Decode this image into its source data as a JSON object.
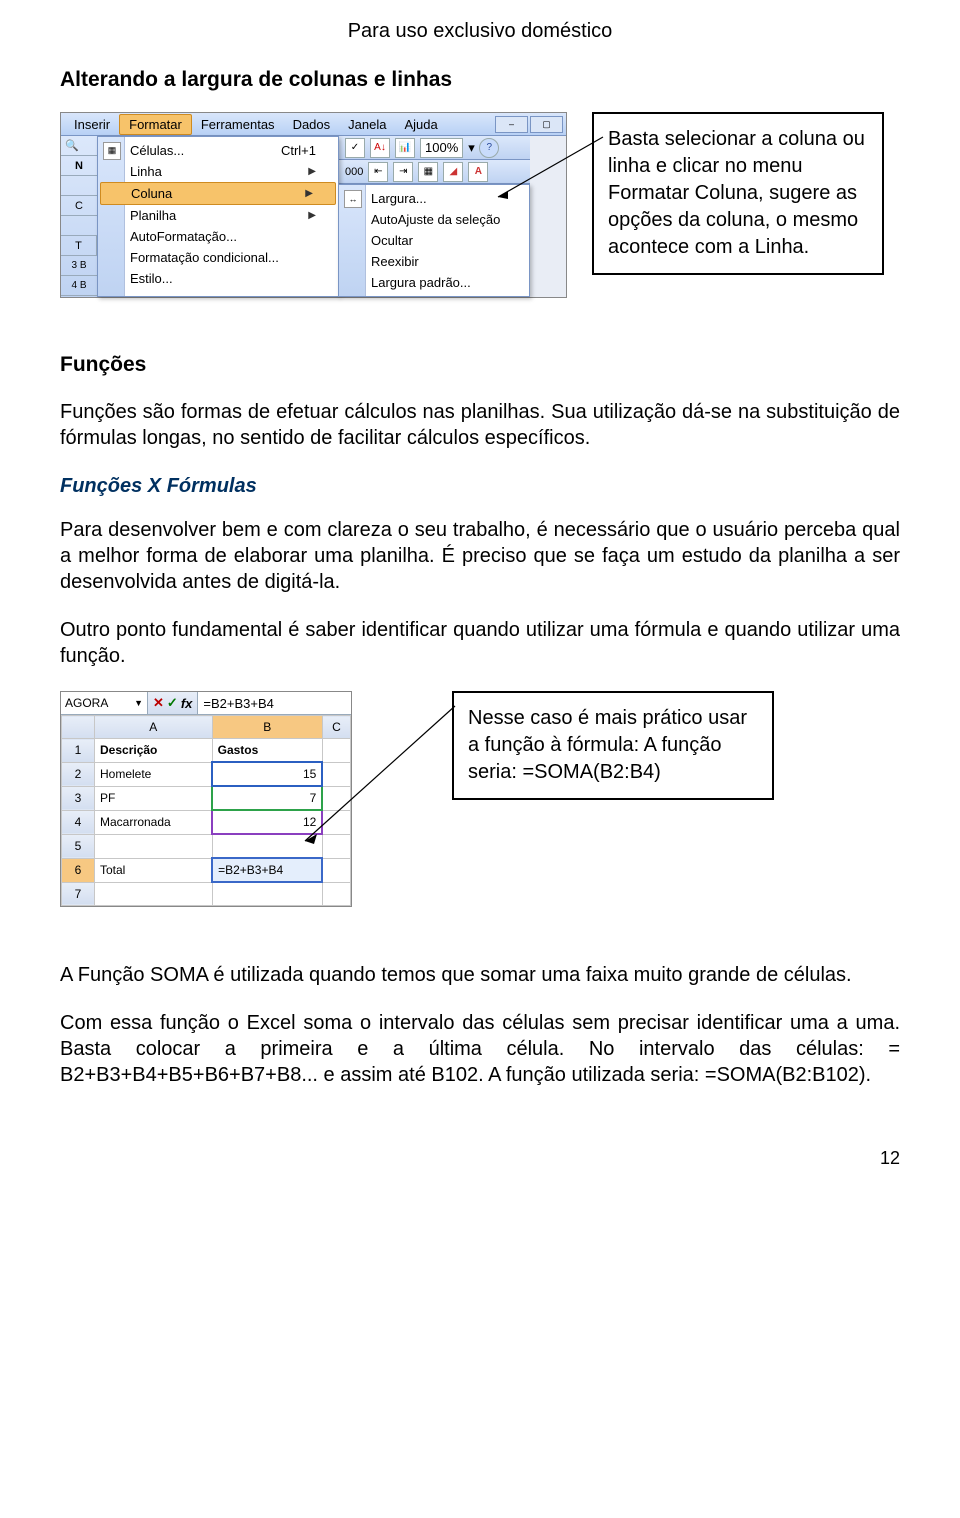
{
  "header_note": "Para uso exclusivo doméstico",
  "title1": "Alterando a largura de colunas e linhas",
  "callout1": "Basta selecionar a coluna ou linha e clicar no menu Formatar Coluna, sugere as opções da coluna, o mesmo acontece com a Linha.",
  "shot1": {
    "menus": [
      "Inserir",
      "Formatar",
      "Ferramentas",
      "Dados",
      "Janela",
      "Ajuda"
    ],
    "toolbar_items": [
      "✓",
      "A↓Z",
      "📊",
      "100%"
    ],
    "zoom": "100%",
    "main_menu": [
      {
        "label": "Células...",
        "shortcut": "Ctrl+1",
        "icon": true
      },
      {
        "label": "Linha",
        "arrow": true
      },
      {
        "label": "Coluna",
        "arrow": true,
        "highlight": true
      },
      {
        "label": "Planilha",
        "arrow": true
      },
      {
        "label": "AutoFormatação...",
        "underline": "F"
      },
      {
        "label": "Formatação condicional...",
        "underline": "d"
      },
      {
        "label": "Estilo...",
        "underline": "E"
      }
    ],
    "sub_menu": [
      {
        "label": "Largura...",
        "icon": true
      },
      {
        "label": "AutoAjuste da seleção"
      },
      {
        "label": "Ocultar"
      },
      {
        "label": "Reexibir"
      },
      {
        "label": "Largura padrão..."
      }
    ],
    "left_labels": [
      "",
      "N",
      "",
      "C",
      "",
      "T",
      "3 B",
      "4 B"
    ]
  },
  "sec2_heading": "Funções",
  "sec2_p1": "Funções são formas de efetuar cálculos nas planilhas. Sua utilização dá-se na substituição de fórmulas longas, no sentido de facilitar cálculos específicos.",
  "sec2_sub": "Funções X Fórmulas",
  "sec2_p2": "Para desenvolver bem e com clareza o seu trabalho, é necessário que o usuário perceba qual a melhor forma de elaborar uma planilha. É preciso que se faça um estudo da planilha a ser desenvolvida antes de digitá-la.",
  "sec2_p3": "Outro ponto fundamental é saber identificar quando utilizar uma fórmula e quando utilizar uma função.",
  "shot2": {
    "namebox": "AGORA",
    "formula": "=B2+B3+B4",
    "cols": [
      "",
      "A",
      "B",
      "C"
    ],
    "rows": [
      {
        "n": "1",
        "a": "Descrição",
        "b": "Gastos",
        "c": "",
        "hdr": true
      },
      {
        "n": "2",
        "a": "Homelete",
        "b": "15",
        "c": "",
        "mark": "blue"
      },
      {
        "n": "3",
        "a": "PF",
        "b": "7",
        "c": "",
        "mark": "green"
      },
      {
        "n": "4",
        "a": "Macarronada",
        "b": "12",
        "c": "",
        "mark": "purple"
      },
      {
        "n": "5",
        "a": "",
        "b": "",
        "c": ""
      },
      {
        "n": "6",
        "a": "Total",
        "b": "=B2+B3+B4",
        "c": "",
        "active": true
      },
      {
        "n": "7",
        "a": "",
        "b": "",
        "c": ""
      }
    ]
  },
  "callout2": "Nesse caso é mais prático usar a função à fórmula: A função seria: =SOMA(B2:B4)",
  "sec3_p1": "A Função SOMA é utilizada quando temos que somar uma faixa muito grande de células.",
  "sec3_p2": "Com essa função o Excel soma o intervalo das células sem precisar identificar uma a uma. Basta colocar a primeira e a última célula. No intervalo das células: = B2+B3+B4+B5+B6+B7+B8... e assim até B102. A função utilizada seria: =SOMA(B2:B102).",
  "page_number": "12"
}
